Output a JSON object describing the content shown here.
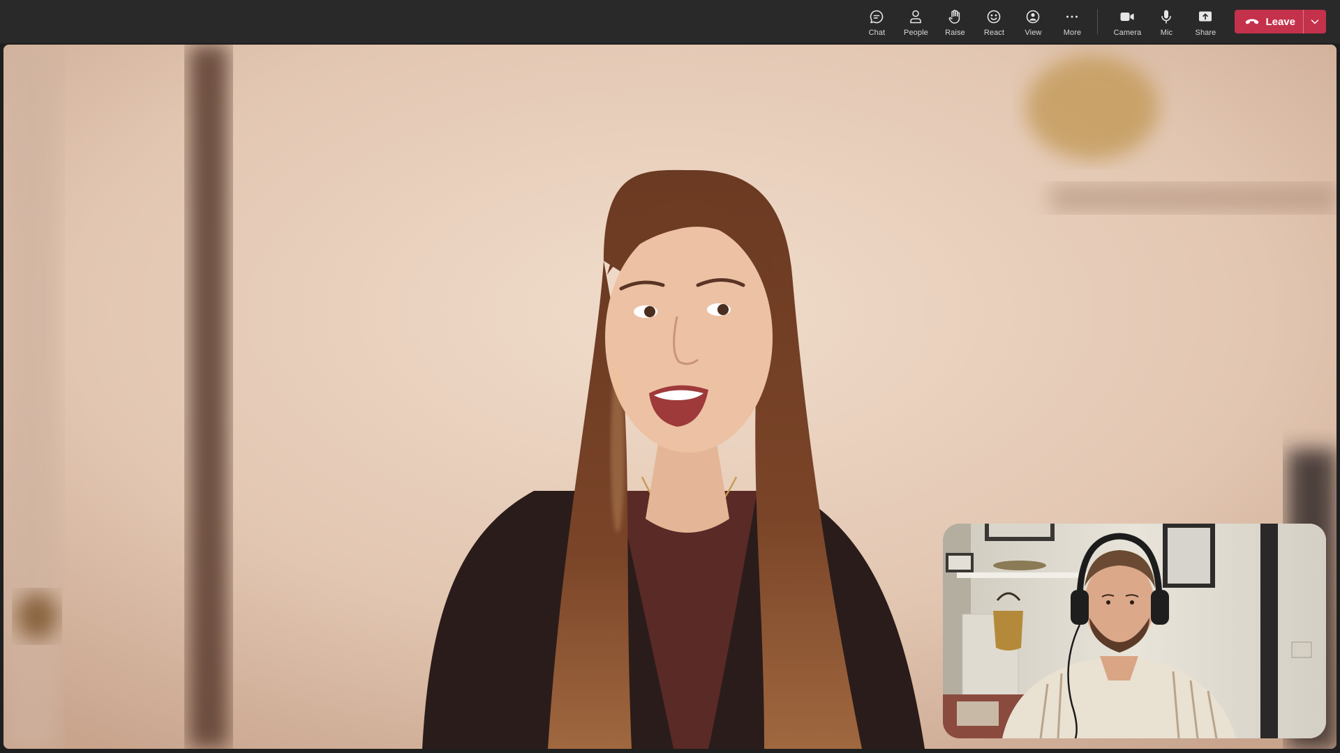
{
  "toolbar": {
    "chat_label": "Chat",
    "people_label": "People",
    "raise_label": "Raise",
    "react_label": "React",
    "view_label": "View",
    "more_label": "More",
    "camera_label": "Camera",
    "mic_label": "Mic",
    "share_label": "Share",
    "leave_label": "Leave"
  },
  "colors": {
    "toolbar_bg": "#292929",
    "leave_bg": "#c4314b",
    "icon": "#e6e6e6"
  },
  "icons": {
    "chat": "chat-bubble-icon",
    "people": "person-icon",
    "raise": "raised-hand-icon",
    "react": "smiley-icon",
    "view": "view-icon",
    "more": "ellipsis-icon",
    "camera": "video-camera-icon",
    "mic": "microphone-icon",
    "share": "share-screen-icon",
    "leave": "phone-hangup-icon",
    "leave_options": "chevron-down-icon"
  }
}
